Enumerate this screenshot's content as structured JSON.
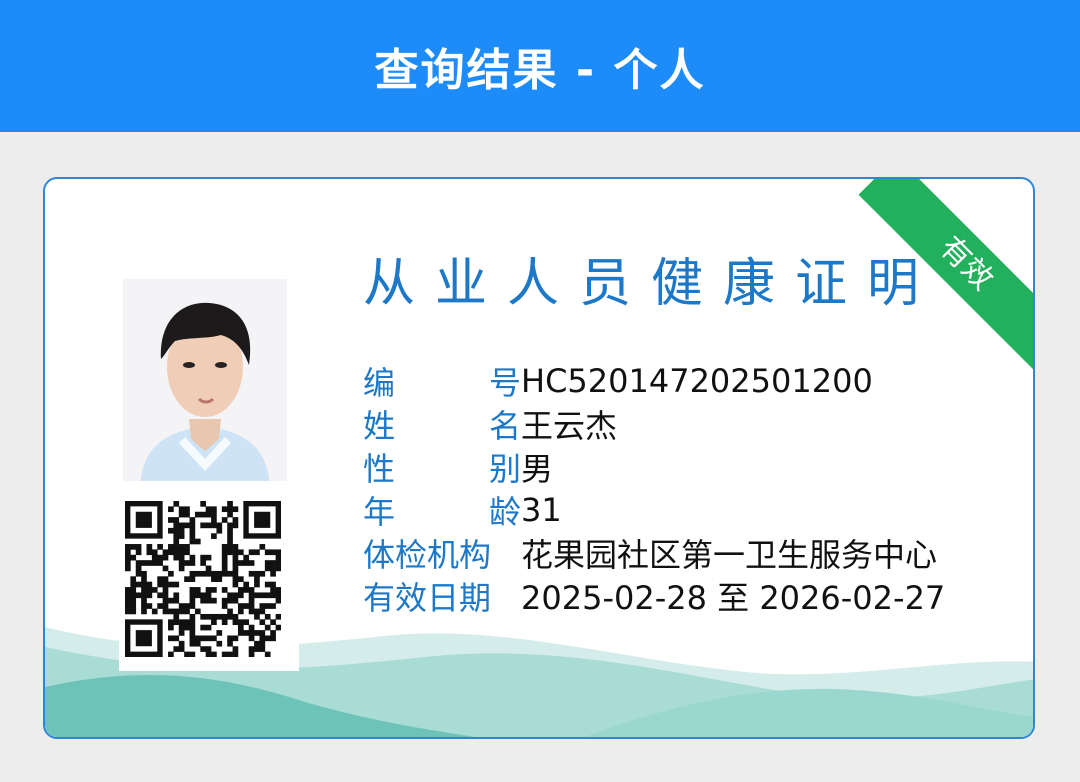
{
  "header": {
    "title": "查询结果 - 个人"
  },
  "card": {
    "title": "从业人员健康证明",
    "badge": "有效",
    "fields": [
      {
        "label_a": "编",
        "label_b": "号",
        "value": "HC520147202501200"
      },
      {
        "label_a": "姓",
        "label_b": "名",
        "value": "王云杰"
      },
      {
        "label_a": "性",
        "label_b": "别",
        "value": "男"
      },
      {
        "label_a": "年",
        "label_b": "龄",
        "value": "31"
      },
      {
        "label_a": "体检机构",
        "label_b": "",
        "value": "花果园社区第一卫生服务中心"
      },
      {
        "label_a": "有效日期",
        "label_b": "",
        "value": "2025-02-28 至 2026-02-27"
      }
    ]
  },
  "colors": {
    "header_bg": "#1d8cf8",
    "accent_blue": "#1d78c8",
    "badge_green": "#22b05c",
    "wave_teal": "#7ccbc0"
  },
  "icons": {
    "photo": "person-photo",
    "qr": "qr-code"
  }
}
